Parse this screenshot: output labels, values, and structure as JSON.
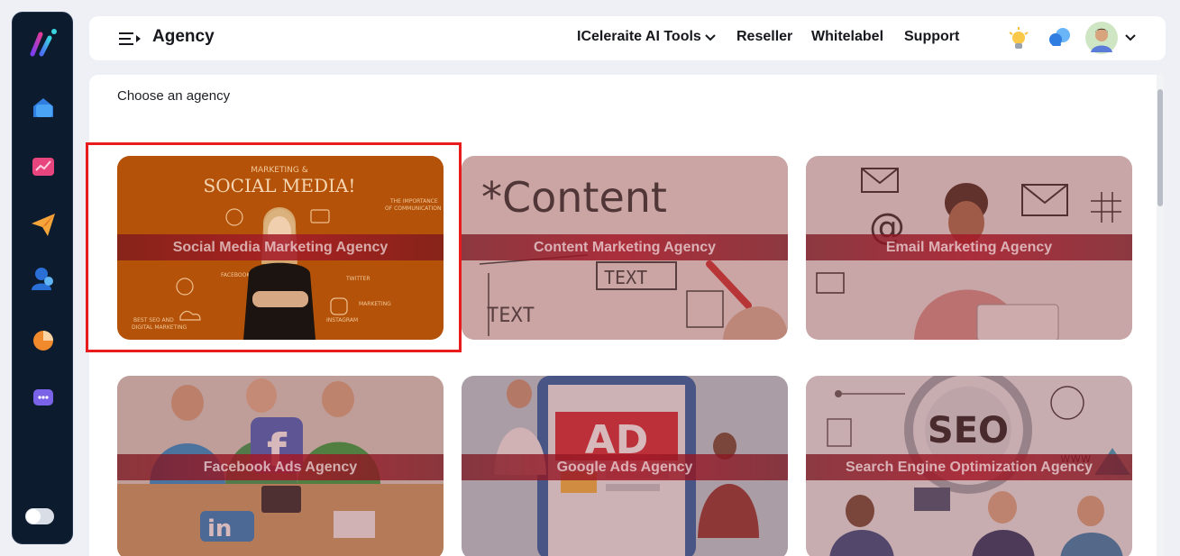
{
  "header": {
    "title": "Agency",
    "nav": [
      {
        "label": "ICeleraite AI Tools",
        "has_dropdown": true
      },
      {
        "label": "Reseller"
      },
      {
        "label": "Whitelabel"
      },
      {
        "label": "Support"
      }
    ]
  },
  "main": {
    "section_label": "Choose an agency",
    "agencies": [
      {
        "label": "Social Media Marketing Agency",
        "selected": true
      },
      {
        "label": "Content Marketing Agency"
      },
      {
        "label": "Email Marketing Agency"
      },
      {
        "label": "Facebook Ads Agency"
      },
      {
        "label": "Google Ads Agency"
      },
      {
        "label": "Search Engine Optimization Agency"
      }
    ],
    "art_text": {
      "social_1": "MARKETING &",
      "social_2": "SOCIAL MEDIA!",
      "social_3": "THE IMPORTANCE",
      "social_4": "OF COMMUNICATION",
      "social_5": "TWITTER",
      "social_6": "FACEBOOK",
      "social_7": "INSTAGRAM",
      "social_8": "MARKETING",
      "social_9": "BEST SEO AND",
      "social_10": "DIGITAL MARKETING",
      "content_1": "*Content",
      "content_2": "TEXT",
      "content_3": "TEXT",
      "google_1": "AD",
      "seo_1": "SEO",
      "seo_2": "www"
    }
  },
  "colors": {
    "accent_red": "#e81c1c",
    "sidebar_bg": "#0d1b2e",
    "band_red": "#a51928"
  },
  "icons": {
    "logo": "app-logo-icon",
    "sidebar": [
      "home-icon",
      "analytics-icon",
      "send-icon",
      "users-icon",
      "pie-chart-icon",
      "chat-icon"
    ],
    "header": [
      "menu-icon",
      "lightbulb-icon",
      "notification-icon",
      "avatar",
      "chevron-down-icon"
    ]
  }
}
